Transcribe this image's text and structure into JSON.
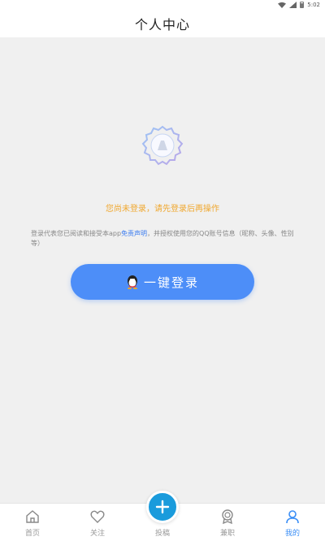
{
  "status_bar": {
    "time": "5:02"
  },
  "header": {
    "title": "个人中心"
  },
  "content": {
    "notice": "您尚未登录，请先登录后再操作",
    "agreement_prefix": "登录代表您已阅读和接受本app",
    "agreement_link": "免责声明",
    "agreement_suffix": "，并授权使用您的QQ账号信息（昵称、头像、性别等）",
    "login_button": "一键登录"
  },
  "tabbar": {
    "items": [
      {
        "label": "首页",
        "icon": "home-icon"
      },
      {
        "label": "关注",
        "icon": "heart-icon"
      },
      {
        "label": "投稿",
        "icon": "plus-icon"
      },
      {
        "label": "兼职",
        "icon": "badge-icon"
      },
      {
        "label": "我的",
        "icon": "user-icon"
      }
    ],
    "active_index": 4
  },
  "colors": {
    "accent": "#4d8ef8",
    "notice": "#f0a830",
    "fab": "#1a9bdc",
    "active_tab": "#3a8ef6"
  }
}
